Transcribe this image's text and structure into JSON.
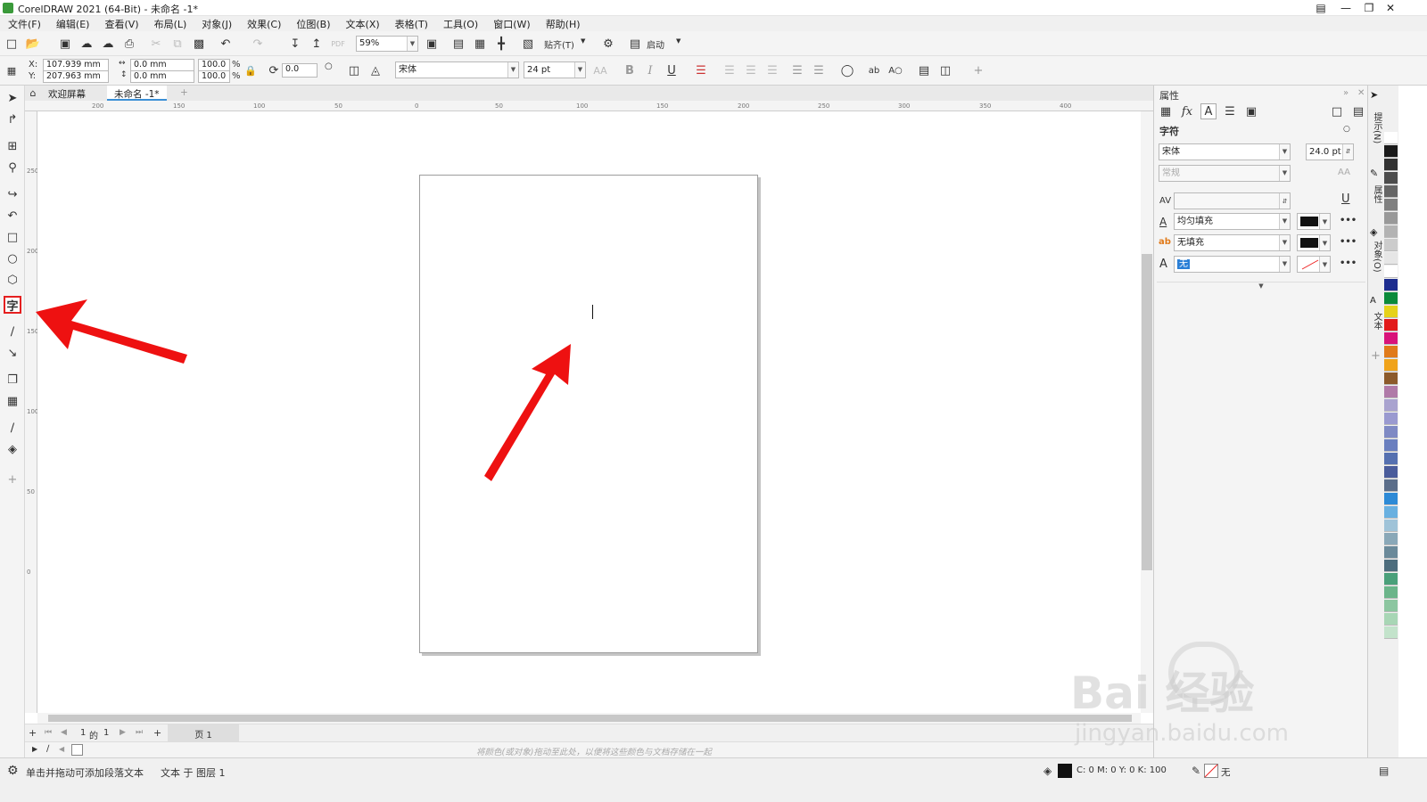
{
  "window": {
    "title": "CorelDRAW 2021 (64-Bit) - 未命名 -1*"
  },
  "menu": [
    "文件(F)",
    "编辑(E)",
    "查看(V)",
    "布局(L)",
    "对象(J)",
    "效果(C)",
    "位图(B)",
    "文本(X)",
    "表格(T)",
    "工具(O)",
    "窗口(W)",
    "帮助(H)"
  ],
  "toolbar": {
    "zoom": "59%",
    "snap_label": "贴齐(T)",
    "launch_label": "启动"
  },
  "propbar": {
    "x_label": "X:",
    "x_value": "107.939 mm",
    "y_label": "Y:",
    "y_value": "207.963 mm",
    "w_value": "0.0 mm",
    "h_value": "0.0 mm",
    "scale_w": "100.0",
    "scale_h": "100.0",
    "pct": "%",
    "rotation": "0.0",
    "font": "宋体",
    "font_size": "24 pt"
  },
  "tabs": {
    "welcome": "欢迎屏幕",
    "document": "未命名 -1*",
    "add": "+"
  },
  "ruler": {
    "h_ticks": [
      "200",
      "150",
      "100",
      "50",
      "0",
      "50",
      "100",
      "150",
      "200",
      "250",
      "300",
      "350",
      "400"
    ],
    "v_ticks": [
      "250",
      "200",
      "150",
      "100",
      "50",
      "0"
    ]
  },
  "pagebar": {
    "current": "1",
    "of": "的",
    "total": "1",
    "page_tab": "页 1"
  },
  "colorbar_hint": "将颜色(或对象)拖动至此处，以便将这些颜色与文档存储在一起",
  "status": {
    "hint": "单击并拖动可添加段落文本",
    "layer": "文本 于 图层 1",
    "fill_info": "C: 0 M: 0 Y: 0 K: 100",
    "outline": "无"
  },
  "properties_panel": {
    "title": "属性",
    "section": "字符",
    "font": "宋体",
    "font_size": "24.0 pt",
    "style": "常规",
    "fill_type": "均匀填充",
    "bg_fill_type": "无填充",
    "outline_type": "无"
  },
  "docker_tabs": [
    "提示(N)",
    "属性",
    "对象(O)",
    "文本"
  ],
  "palette_colors": [
    "#ffffff",
    "#1a1a1a",
    "#333333",
    "#4d4d4d",
    "#666666",
    "#808080",
    "#999999",
    "#b3b3b3",
    "#cccccc",
    "#e6e6e6",
    "#ffffff",
    "#1d2d8f",
    "#0b8a3a",
    "#e6d21a",
    "#e21b1b",
    "#d8137a",
    "#e07a1a",
    "#f0a31a",
    "#8c5a2b",
    "#b07aa8",
    "#a9a3cf",
    "#9a9ad0",
    "#7f8ac4",
    "#6a7fbf",
    "#5570b0",
    "#4a5c9b",
    "#5b6e8a",
    "#2d8ad6",
    "#69b0e0",
    "#9fc3d8",
    "#8aa8b8",
    "#6b8a9a",
    "#4d6d7d",
    "#4aa07a",
    "#6bb58a",
    "#8cc6a0",
    "#a8d6b5",
    "#c3e3cb"
  ],
  "watermark": {
    "brand": "Bai 经验",
    "url": "jingyan.baidu.com"
  }
}
